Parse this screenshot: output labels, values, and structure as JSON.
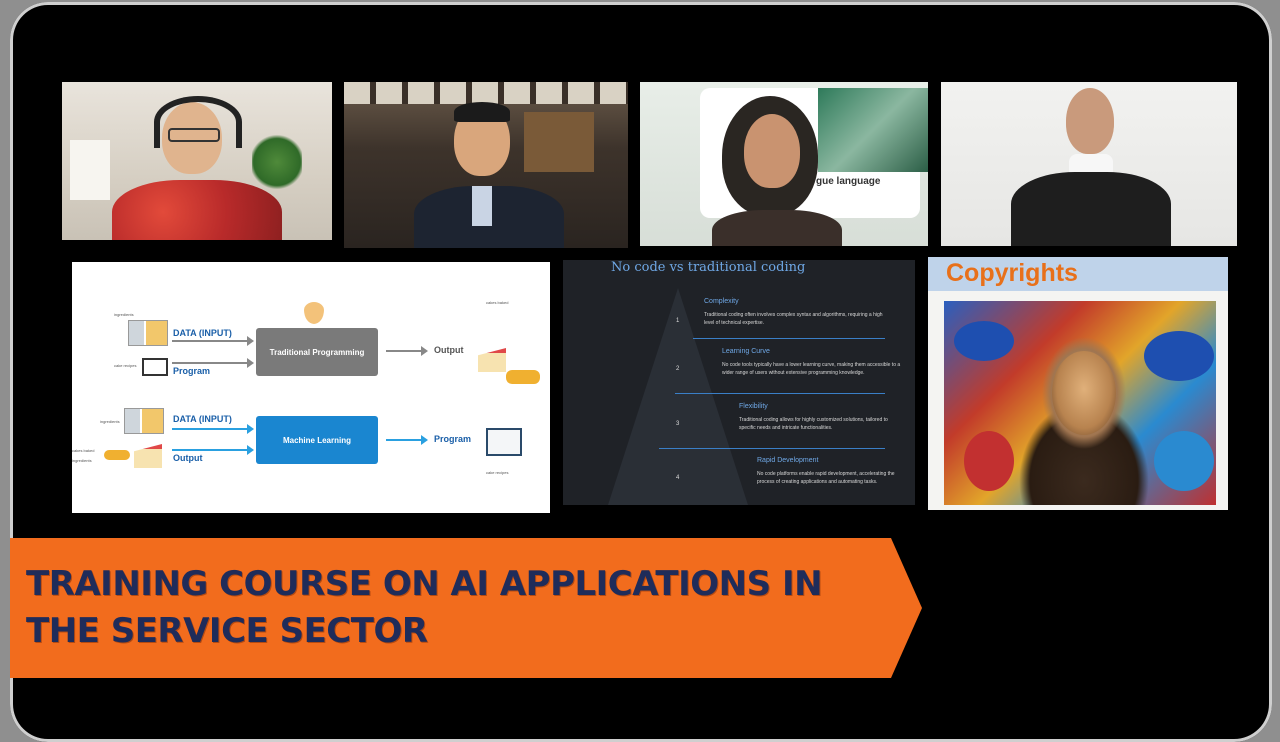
{
  "banner": {
    "line1": "TRAINING COURSE ON AI APPLICATIONS IN",
    "line2": "THE SERVICE SECTOR"
  },
  "cam3": {
    "overlay_text": "gue language"
  },
  "slide_ml": {
    "top_small_ingredients": "ingredients",
    "data_input_top": "DATA (INPUT)",
    "traditional_programming": "Traditional Programming",
    "output_top": "Output",
    "cakes_baked": "cakes baked",
    "cake_recipes_top": "cake recipes",
    "program_top": "Program",
    "bottom_small_ingredients": "ingredients",
    "data_input_bottom": "DATA (INPUT)",
    "machine_learning": "Machine Learning",
    "program_bottom": "Program",
    "cakes_baked_bottom": "cakes baked",
    "ingredients_bottom2": "ingredients",
    "output_bottom": "Output",
    "cake_recipes_bottom": "cake recipes"
  },
  "slide_nocode": {
    "title": "No code vs traditional coding",
    "rows": [
      {
        "num": "1",
        "heading": "Complexity",
        "desc": "Traditional coding often involves complex syntax and algorithms, requiring a high level of technical expertise."
      },
      {
        "num": "2",
        "heading": "Learning Curve",
        "desc": "No code tools typically have a lower learning curve, making them accessible to a wider range of users without extensive programming knowledge."
      },
      {
        "num": "3",
        "heading": "Flexibility",
        "desc": "Traditional coding allows for highly customized solutions, tailored to specific needs and intricate functionalities."
      },
      {
        "num": "4",
        "heading": "Rapid Development",
        "desc": "No code platforms enable rapid development, accelerating the process of creating applications and automating tasks."
      }
    ]
  },
  "slide_copyright": {
    "title": "Copyrights"
  },
  "colors": {
    "banner": "#f26c1d",
    "banner_text": "#1f2c5a",
    "accent_blue": "#6fa8e6",
    "orange_title": "#e8701a"
  }
}
